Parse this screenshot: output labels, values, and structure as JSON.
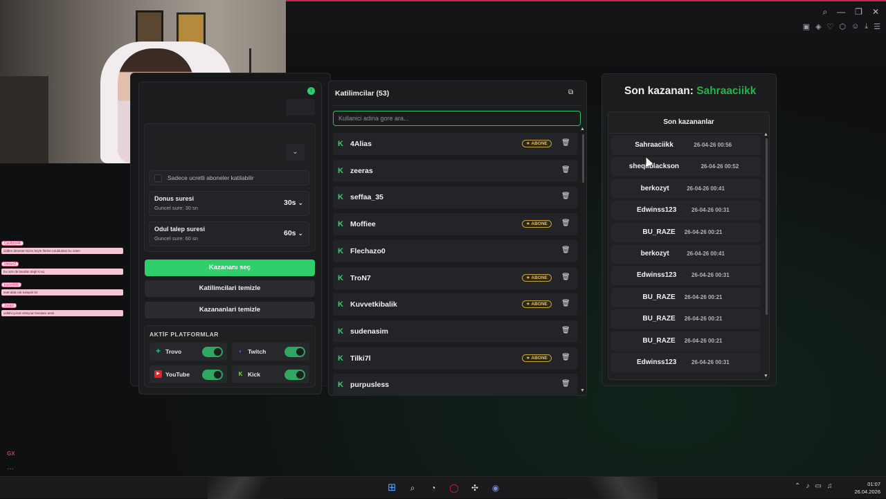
{
  "left_panel": {
    "subscriber_option": "Sadece ucretli aboneler katilabilir",
    "spin_time": {
      "title": "Donus suresi",
      "subtitle": "Guncel sure: 30 sn",
      "value": "30s"
    },
    "claim_time": {
      "title": "Odul talep suresi",
      "subtitle": "Guncel sure: 60 sn",
      "value": "60s"
    },
    "buttons": {
      "pick_winner": "Kazananı seç",
      "clear_participants": "Katilimcilari temizle",
      "clear_winners": "Kazananlari temizle"
    },
    "platforms": {
      "title": "AKTİF PLATFORMLAR",
      "items": [
        {
          "name": "Trovo",
          "enabled": true,
          "color": "#1fb87a"
        },
        {
          "name": "Twitch",
          "enabled": true,
          "color": "#9146ff"
        },
        {
          "name": "YouTube",
          "enabled": true,
          "color": "#e02424"
        },
        {
          "name": "Kick",
          "enabled": true,
          "color": "#53fc18"
        }
      ]
    }
  },
  "participants": {
    "title": "Katilimcilar (53)",
    "search_placeholder": "Kullanici adina gore ara...",
    "badge_label": "ABONE",
    "items": [
      {
        "name": "4Alias",
        "subscriber": true
      },
      {
        "name": "zeeras",
        "subscriber": false
      },
      {
        "name": "seffaa_35",
        "subscriber": false
      },
      {
        "name": "Moffiee",
        "subscriber": true
      },
      {
        "name": "Flechazo0",
        "subscriber": false
      },
      {
        "name": "TroN7",
        "subscriber": true
      },
      {
        "name": "Kuvvetkibalik",
        "subscriber": true
      },
      {
        "name": "sudenasim",
        "subscriber": false
      },
      {
        "name": "Tilki7l",
        "subscriber": true
      },
      {
        "name": "purpusless",
        "subscriber": false
      }
    ]
  },
  "winners": {
    "last_winner_label": "Son kazanan:",
    "last_winner_name": "Sahraaciikk",
    "list_title": "Son kazananlar",
    "items": [
      {
        "name": "Sahraaciikk",
        "time": "26-04-26 00:56"
      },
      {
        "name": "sheqilblackson",
        "time": "26-04-26 00:52"
      },
      {
        "name": "berkozyt",
        "time": "26-04-26 00:41"
      },
      {
        "name": "Edwinss123",
        "time": "26-04-26 00:31"
      },
      {
        "name": "BU_RAZE",
        "time": "26-04-26 00:21"
      },
      {
        "name": "berkozyt",
        "time": "26-04-26 00:41"
      },
      {
        "name": "Edwinss123",
        "time": "26-04-26 00:31"
      },
      {
        "name": "BU_RAZE",
        "time": "26-04-26 00:21"
      },
      {
        "name": "BU_RAZE",
        "time": "26-04-26 00:21"
      },
      {
        "name": "BU_RAZE",
        "time": "26-04-26 00:21"
      },
      {
        "name": "Edwinss123",
        "time": "26-04-26 00:31"
      }
    ]
  },
  "chat_overlay": {
    "messages": [
      {
        "user": "Caviboy44",
        "text": "cidden denesen kizim böyle flörtün tutulduktan bu zaten"
      },
      {
        "user": "viewer2",
        "text": "bu raze de bandan degil ki aq"
      },
      {
        "user": "kuvvetkib",
        "text": "evet abla cok kolaydir bir"
      },
      {
        "user": "Zarazl",
        "text": "vallahi çocuk olmiycan bendanı anek"
      }
    ]
  },
  "browser": {
    "brand": "GX"
  },
  "taskbar": {
    "time": "01:07",
    "date": "26.04.2026"
  }
}
